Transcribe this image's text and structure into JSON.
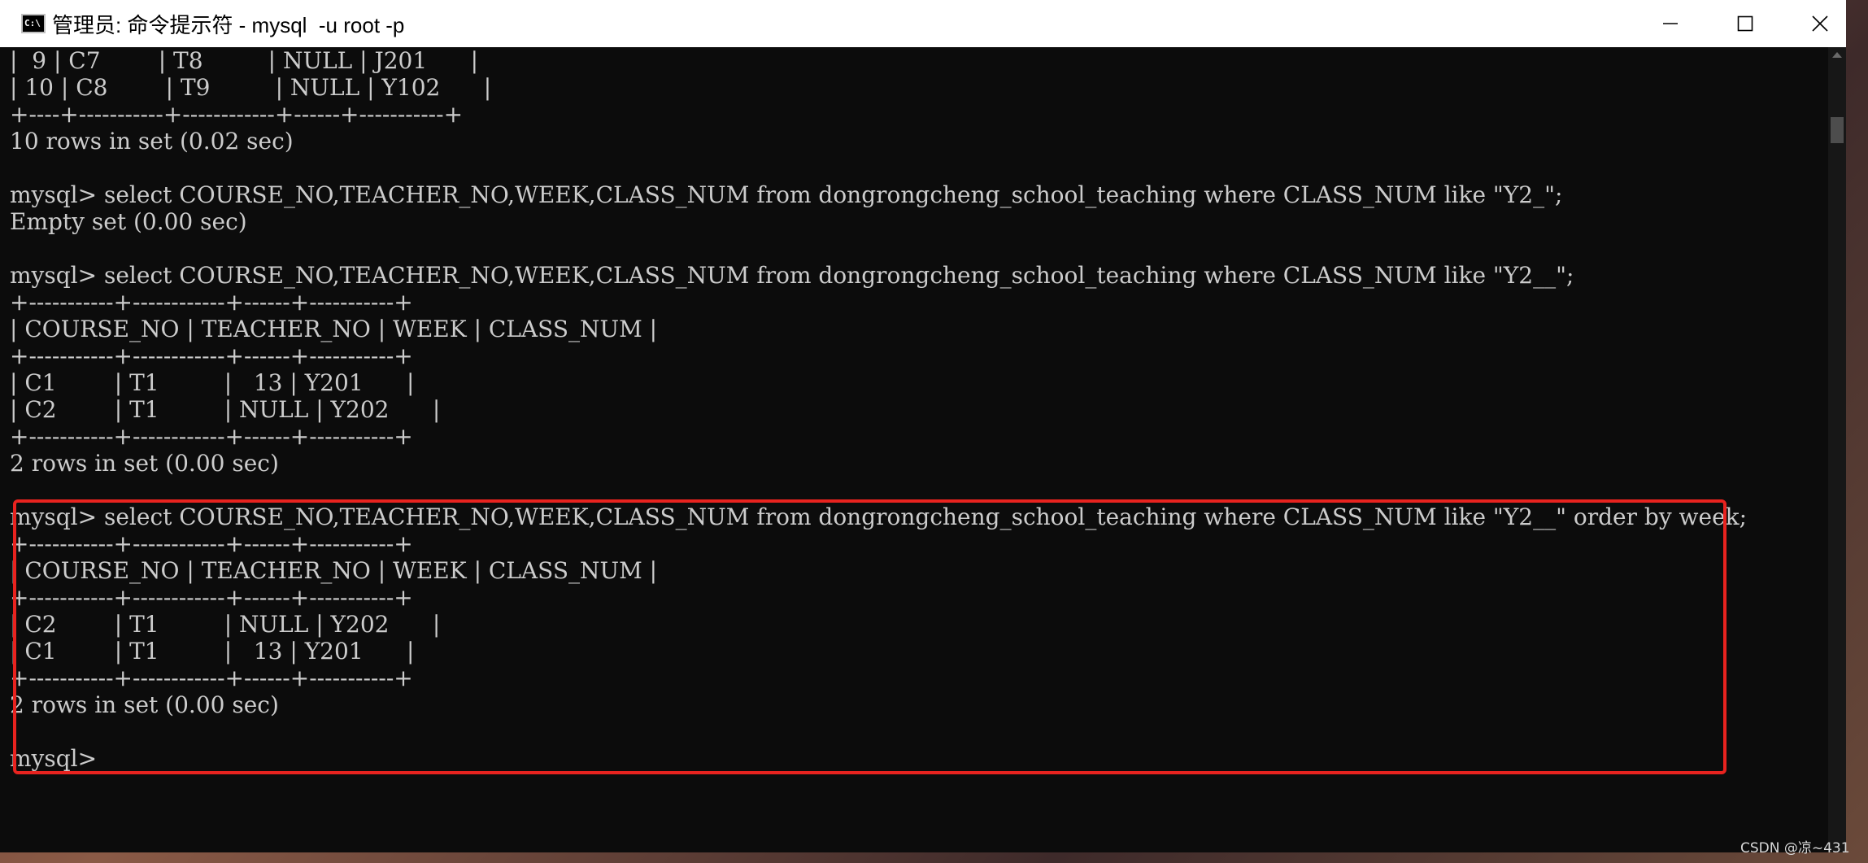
{
  "window": {
    "title": "管理员: 命令提示符 - mysql  -u root -p",
    "icon": "cmd-icon",
    "icon_text": "C:\\"
  },
  "controls": {
    "minimize": "minimize-icon",
    "maximize": "maximize-icon",
    "close": "close-icon"
  },
  "terminal": {
    "lines": [
      "|  9 | C7        | T8         | NULL | J201      |",
      "| 10 | C8        | T9         | NULL | Y102      |",
      "+----+-----------+------------+------+-----------+",
      "10 rows in set (0.02 sec)",
      "",
      "mysql> select COURSE_NO,TEACHER_NO,WEEK,CLASS_NUM from dongrongcheng_school_teaching where CLASS_NUM like \"Y2_\";",
      "Empty set (0.00 sec)",
      "",
      "mysql> select COURSE_NO,TEACHER_NO,WEEK,CLASS_NUM from dongrongcheng_school_teaching where CLASS_NUM like \"Y2__\";",
      "+-----------+------------+------+-----------+",
      "| COURSE_NO | TEACHER_NO | WEEK | CLASS_NUM |",
      "+-----------+------------+------+-----------+",
      "| C1        | T1         |   13 | Y201      |",
      "| C2        | T1         | NULL | Y202      |",
      "+-----------+------------+------+-----------+",
      "2 rows in set (0.00 sec)",
      "",
      "mysql> select COURSE_NO,TEACHER_NO,WEEK,CLASS_NUM from dongrongcheng_school_teaching where CLASS_NUM like \"Y2__\" order by week;",
      "+-----------+------------+------+-----------+",
      "| COURSE_NO | TEACHER_NO | WEEK | CLASS_NUM |",
      "+-----------+------------+------+-----------+",
      "| C2        | T1         | NULL | Y202      |",
      "| C1        | T1         |   13 | Y201      |",
      "+-----------+------------+------+-----------+",
      "2 rows in set (0.00 sec)",
      "",
      "mysql> "
    ]
  },
  "colors": {
    "terminal_bg": "#0c0c0c",
    "terminal_fg": "#cccccc",
    "highlight": "#e8231f"
  },
  "watermark": "CSDN @凉~431"
}
